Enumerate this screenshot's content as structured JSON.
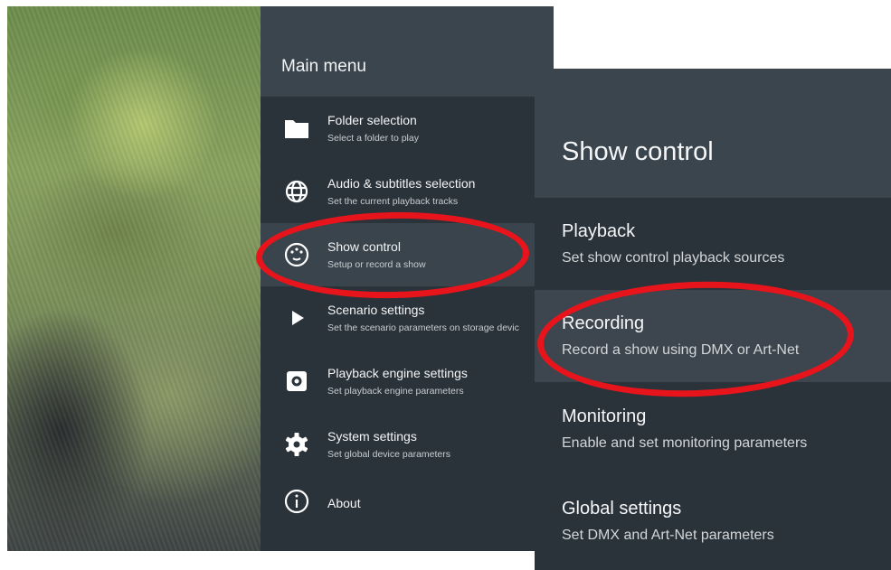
{
  "main_menu": {
    "title": "Main menu",
    "items": [
      {
        "label": "Folder selection",
        "sub": "Select a folder to play",
        "icon": "folder-icon"
      },
      {
        "label": "Audio & subtitles selection",
        "sub": "Set the current playback tracks",
        "icon": "globe-icon"
      },
      {
        "label": "Show control",
        "sub": "Setup or record a show",
        "icon": "show-control-icon",
        "selected": true
      },
      {
        "label": "Scenario settings",
        "sub": "Set the scenario parameters on storage devic",
        "icon": "play-icon"
      },
      {
        "label": "Playback engine settings",
        "sub": "Set playback engine parameters",
        "icon": "engine-settings-icon"
      },
      {
        "label": "System settings",
        "sub": "Set global device parameters",
        "icon": "gear-icon"
      },
      {
        "label": "About",
        "sub": "",
        "icon": "info-icon"
      }
    ]
  },
  "show_control": {
    "title": "Show control",
    "items": [
      {
        "label": "Playback",
        "sub": "Set show control playback sources"
      },
      {
        "label": "Recording",
        "sub": "Record a show using DMX or Art-Net",
        "selected": true
      },
      {
        "label": "Monitoring",
        "sub": "Enable and set monitoring parameters"
      },
      {
        "label": "Global settings",
        "sub": "Set DMX and Art-Net parameters"
      }
    ]
  },
  "colors": {
    "panel": "#2b333a",
    "header": "#3a454e",
    "selected": "#3a444c",
    "annotation": "#e8141c"
  }
}
